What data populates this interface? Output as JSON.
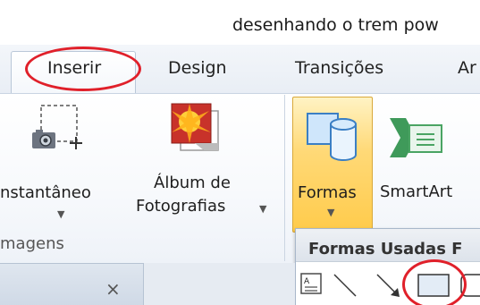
{
  "window": {
    "title": "desenhando o trem pow"
  },
  "tabs": [
    {
      "label": "Inserir",
      "active": true
    },
    {
      "label": "Design"
    },
    {
      "label": "Transições"
    },
    {
      "label": "Ar"
    }
  ],
  "groups": {
    "imagens": {
      "label": "magens",
      "instantaneo_label": "nstantâneo",
      "album_label_line1": "Álbum de",
      "album_label_line2": "Fotografias"
    },
    "ilustracoes": {
      "formas_label": "Formas",
      "smartart_label": "SmartArt"
    }
  },
  "shapes_dropdown": {
    "header": "Formas Usadas F"
  },
  "pane": {
    "close_symbol": "×"
  },
  "colors": {
    "highlight_red": "#e0202a",
    "selected_gold": "#ffcb4b"
  }
}
